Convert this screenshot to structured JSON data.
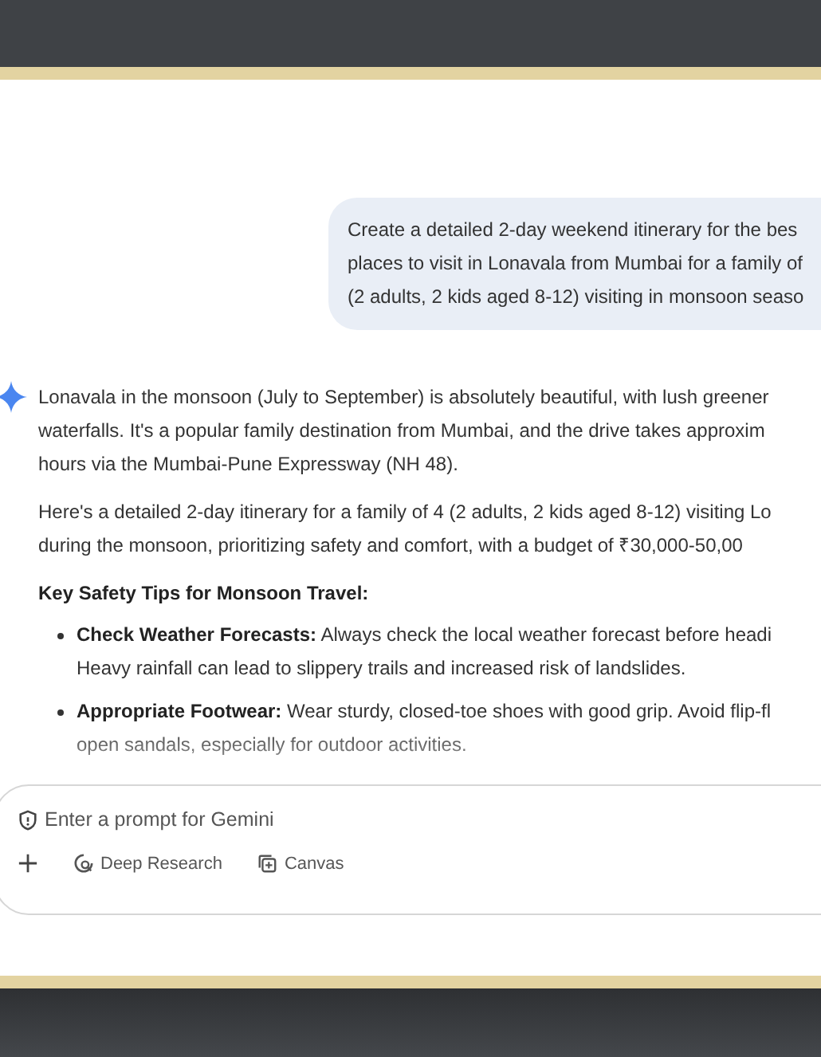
{
  "user_message": {
    "lines": [
      "Create a detailed 2-day weekend itinerary for the bes",
      "places to visit in Lonavala from Mumbai for a family of",
      "(2 adults, 2 kids aged 8-12) visiting in monsoon seaso"
    ]
  },
  "response": {
    "paragraphs": [
      {
        "lines": [
          "Lonavala in the monsoon (July to September) is absolutely beautiful, with lush greener",
          "waterfalls. It's a popular family destination from Mumbai, and the drive takes approxim",
          "hours via the Mumbai-Pune Expressway (NH 48)."
        ]
      },
      {
        "lines": [
          "Here's a detailed 2-day itinerary for a family of 4 (2 adults, 2 kids aged 8-12) visiting Lo",
          "during the monsoon, prioritizing safety and comfort, with a budget of ₹30,000-50,00"
        ]
      }
    ],
    "heading": "Key Safety Tips for Monsoon Travel:",
    "bullets": [
      {
        "lines": [
          "**Check Weather Forecasts:** Always check the local weather forecast before headi",
          "Heavy rainfall can lead to slippery trails and increased risk of landslides."
        ]
      },
      {
        "lines": [
          "**Appropriate Footwear:** Wear sturdy, closed-toe shoes with good grip. Avoid flip-fl",
          "open sandals, especially for outdoor activities."
        ]
      }
    ]
  },
  "prompt_box": {
    "placeholder": "Enter a prompt for Gemini",
    "tools": [
      {
        "kind": "deep_research",
        "label": "Deep Research"
      },
      {
        "kind": "canvas",
        "label": "Canvas"
      }
    ]
  }
}
